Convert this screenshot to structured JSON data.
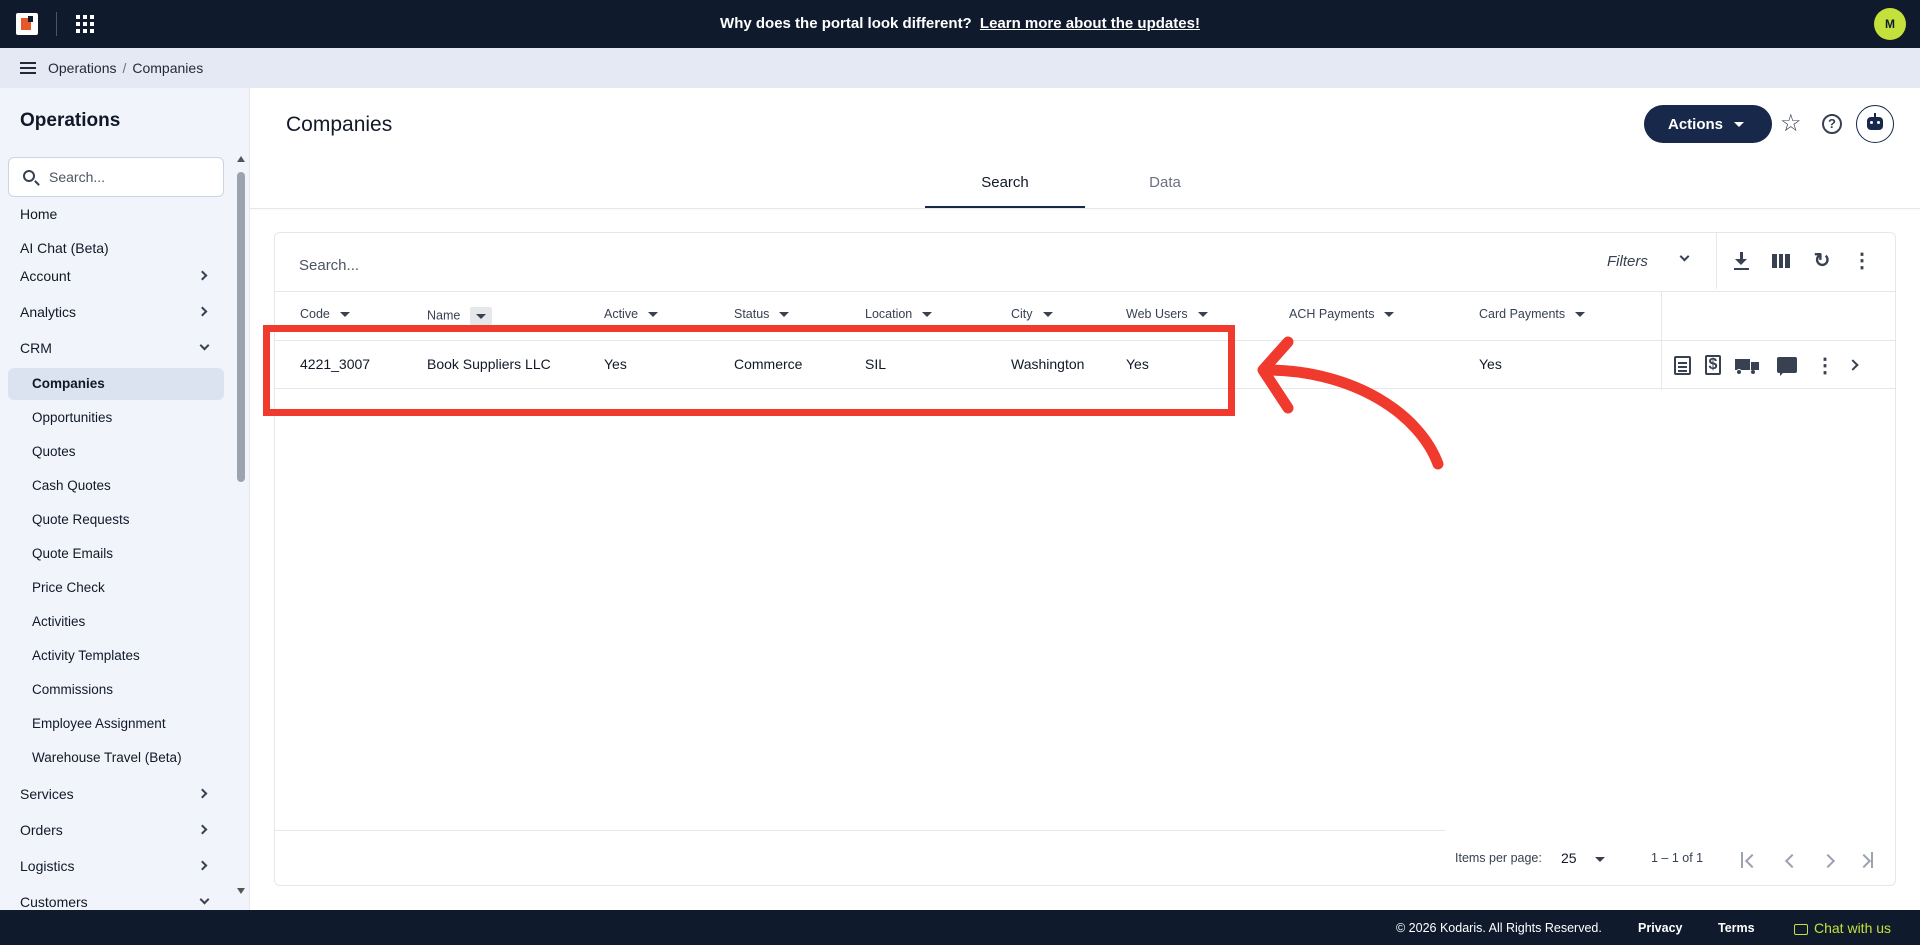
{
  "topbar": {
    "banner_text": "Why does the portal look different?",
    "banner_link": "Learn more about the updates!",
    "avatar_initial": "M"
  },
  "breadcrumb": {
    "root": "Operations",
    "sep": "/",
    "current": "Companies"
  },
  "sidebar": {
    "title": "Operations",
    "search_placeholder": "Search...",
    "items": [
      {
        "label": "Home",
        "type": "plain"
      },
      {
        "label": "AI Chat (Beta)",
        "type": "plain"
      },
      {
        "label": "Account",
        "type": "collapsed"
      },
      {
        "label": "Analytics",
        "type": "collapsed"
      },
      {
        "label": "CRM",
        "type": "expanded"
      },
      {
        "label": "Companies",
        "type": "sub-active"
      },
      {
        "label": "Opportunities",
        "type": "sub"
      },
      {
        "label": "Quotes",
        "type": "sub"
      },
      {
        "label": "Cash Quotes",
        "type": "sub"
      },
      {
        "label": "Quote Requests",
        "type": "sub"
      },
      {
        "label": "Quote Emails",
        "type": "sub"
      },
      {
        "label": "Price Check",
        "type": "sub"
      },
      {
        "label": "Activities",
        "type": "sub"
      },
      {
        "label": "Activity Templates",
        "type": "sub"
      },
      {
        "label": "Commissions",
        "type": "sub"
      },
      {
        "label": "Employee Assignment",
        "type": "sub"
      },
      {
        "label": "Warehouse Travel (Beta)",
        "type": "sub"
      },
      {
        "label": "Services",
        "type": "collapsed"
      },
      {
        "label": "Orders",
        "type": "collapsed"
      },
      {
        "label": "Logistics",
        "type": "collapsed"
      },
      {
        "label": "Customers",
        "type": "expanded"
      }
    ]
  },
  "page": {
    "title": "Companies",
    "actions_label": "Actions",
    "help_glyph": "?",
    "star_glyph": "☆",
    "tabs": [
      {
        "label": "Search",
        "active": true
      },
      {
        "label": "Data",
        "active": false
      }
    ]
  },
  "grid": {
    "search_placeholder": "Search...",
    "filters_label": "Filters",
    "refresh_glyph": "↻",
    "more_glyph": "⋮",
    "columns": [
      "Code",
      "Name",
      "Active",
      "Status",
      "Location",
      "City",
      "Web Users",
      "ACH Payments",
      "Card Payments"
    ],
    "rows": [
      [
        "4221_3007",
        "Book Suppliers LLC",
        "Yes",
        "Commerce",
        "SIL",
        "Washington",
        "Yes",
        "",
        "Yes"
      ]
    ],
    "pager": {
      "items_per_page_label": "Items per page:",
      "page_size": "25",
      "range": "1 – 1 of 1"
    }
  },
  "annotation": {
    "color": "#f03a2e"
  },
  "footer": {
    "copyright": "© 2026 Kodaris. All Rights Reserved.",
    "privacy": "Privacy",
    "terms": "Terms",
    "chat": "Chat with us"
  }
}
